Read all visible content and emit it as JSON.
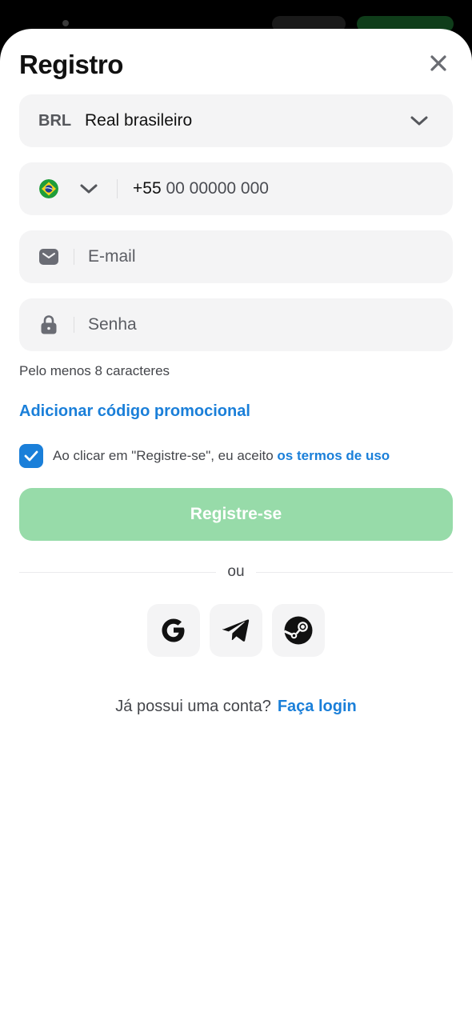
{
  "modal": {
    "title": "Registro"
  },
  "currency": {
    "code": "BRL",
    "name": "Real brasileiro"
  },
  "phone": {
    "country_code": "+55",
    "number_placeholder": "00 00000 000"
  },
  "email": {
    "placeholder": "E-mail"
  },
  "password": {
    "placeholder": "Senha",
    "hint": "Pelo menos 8 caracteres"
  },
  "promo": {
    "link_label": "Adicionar código promocional"
  },
  "terms": {
    "checked": true,
    "text": "Ao clicar em \"Registre-se\", eu aceito ",
    "link_label": "os termos de uso"
  },
  "submit": {
    "label": "Registre-se"
  },
  "divider": {
    "label": "ou"
  },
  "social": {
    "providers": [
      "google",
      "telegram",
      "steam"
    ]
  },
  "login": {
    "prompt": "Já possui uma conta?",
    "link_label": "Faça login"
  },
  "colors": {
    "accent": "#1a7fd9",
    "submit_disabled": "#97dba9",
    "field_bg": "#f4f4f5"
  }
}
